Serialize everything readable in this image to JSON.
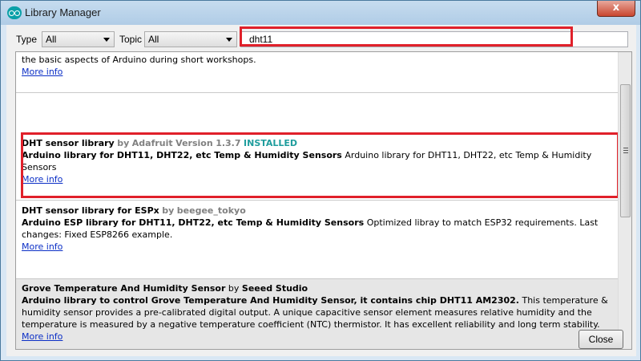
{
  "window": {
    "title": "Library Manager",
    "close_glyph": "x"
  },
  "filters": {
    "type_label": "Type",
    "type_value": "All",
    "topic_label": "Topic",
    "topic_value": "All",
    "search_value": "dht11"
  },
  "colors": {
    "highlight": "#e0202a",
    "installed": "#1f9d9d",
    "link": "#0b2fc6"
  },
  "entries": [
    {
      "desc_rest": "the basic aspects of Arduino during short workshops.",
      "more": "More info"
    },
    {
      "name": "DHT sensor library",
      "by": "by",
      "author": "Adafruit",
      "version_label": "Version",
      "version": "1.3.7",
      "status": "INSTALLED",
      "desc_bold": "Arduino library for DHT11, DHT22, etc Temp & Humidity Sensors",
      "desc_rest": "Arduino library for DHT11, DHT22, etc Temp & Humidity Sensors",
      "more": "More info"
    },
    {
      "name": "DHT sensor library for ESPx",
      "by": "by",
      "author": "beegee_tokyo",
      "desc_bold": "Arduino ESP library for DHT11, DHT22, etc Temp & Humidity Sensors",
      "desc_rest": "Optimized libray to match ESP32 requirements. Last changes: Fixed ESP8266 example.",
      "more": "More info"
    },
    {
      "name": "Grove Temperature And Humidity Sensor",
      "by": "by",
      "author": "Seeed Studio",
      "desc_bold": "Arduino library to control Grove Temperature And Humidity Sensor, it contains chip DHT11 AM2302.",
      "desc_rest": "This temperature & humidity sensor provides a pre-calibrated digital output. A unique capacitive sensor element measures relative humidity and the temperature is measured by a negative temperature coefficient (NTC) thermistor. It has excellent reliability and long term stability.",
      "more": "More info"
    }
  ],
  "footer": {
    "close_label": "Close"
  }
}
